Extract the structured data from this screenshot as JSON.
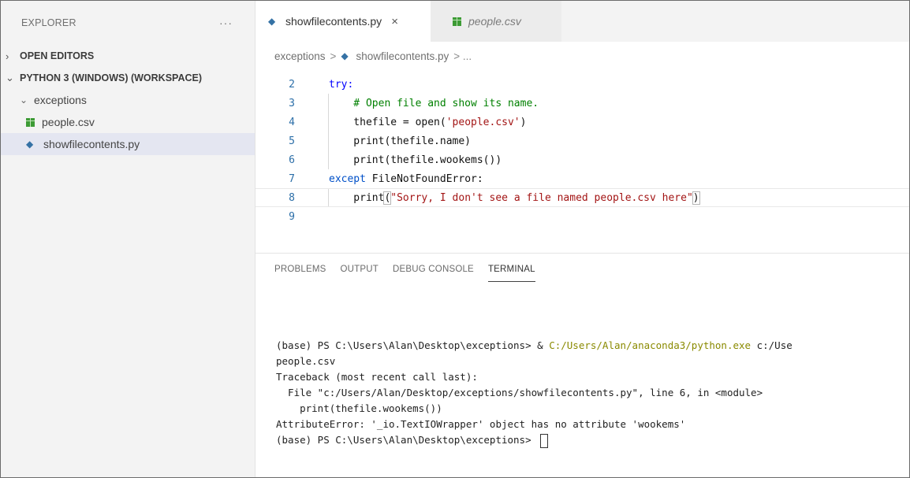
{
  "sidebar": {
    "title": "EXPLORER",
    "more": "···",
    "open_editors": "OPEN EDITORS",
    "workspace": "PYTHON 3 (WINDOWS) (WORKSPACE)",
    "folder": "exceptions",
    "files": [
      "people.csv",
      "showfilecontents.py"
    ]
  },
  "tabs": {
    "active": "showfilecontents.py",
    "close": "×",
    "inactive": "people.csv"
  },
  "breadcrumbs": {
    "folder": "exceptions",
    "sep": ">",
    "file": "showfilecontents.py",
    "more": "> ..."
  },
  "code": {
    "line_numbers": [
      "2",
      "3",
      "4",
      "5",
      "6",
      "7",
      "8",
      "9"
    ],
    "l2_kw": "try:",
    "l3": "    # Open file and show its name.",
    "l4_pre": "    thefile = open(",
    "l4_str": "'people.csv'",
    "l4_post": ")",
    "l5": "    print(thefile.name)",
    "l6": "    print(thefile.wookems())",
    "l7_kw": "except",
    "l7_rest": " FileNotFoundError:",
    "l8_pre": "    print",
    "l8_open": "(",
    "l8_str": "\"Sorry, I don't see a file named people.csv here\"",
    "l8_close": ")"
  },
  "panel": {
    "tabs": [
      "PROBLEMS",
      "OUTPUT",
      "DEBUG CONSOLE",
      "TERMINAL"
    ],
    "terminal": {
      "l1_pre": "(base) PS C:\\Users\\Alan\\Desktop\\exceptions> & ",
      "l1_path": "C:/Users/Alan/anaconda3/python.exe",
      "l1_post": " c:/Use",
      "l2": "people.csv",
      "l3": "Traceback (most recent call last):",
      "l4": "  File \"c:/Users/Alan/Desktop/exceptions/showfilecontents.py\", line 6, in <module>",
      "l5": "    print(thefile.wookems())",
      "l6": "AttributeError: '_io.TextIOWrapper' object has no attribute 'wookems'",
      "l7": "(base) PS C:\\Users\\Alan\\Desktop\\exceptions> "
    }
  },
  "colors": {
    "sidebar_bg": "#f3f3f3",
    "selected_bg": "#e4e6f1",
    "keyword": "#0000ff",
    "string": "#a31515",
    "comment": "#008000",
    "line_number": "#2b6ea8"
  }
}
